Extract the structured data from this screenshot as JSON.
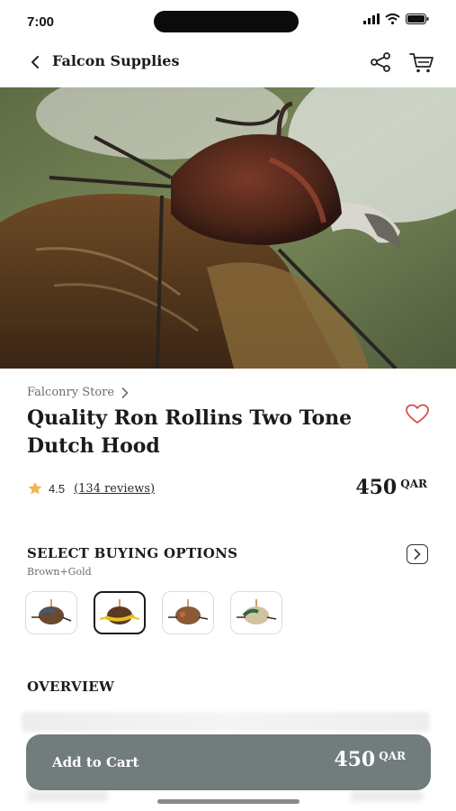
{
  "status_bar": {
    "time": "7:00"
  },
  "nav": {
    "title": "Falcon Supplies",
    "back_icon": "chevron-left-icon",
    "share_icon": "share-icon",
    "cart_icon": "cart-icon"
  },
  "hero": {
    "image": "hooded-falcon-photo"
  },
  "product": {
    "store": "Falconry Store",
    "title": "Quality Ron Rollins Two Tone Dutch Hood",
    "rating": "4.5",
    "reviews": "(134 reviews)",
    "price": "450",
    "currency": "QAR"
  },
  "options": {
    "title": "SELECT BUYING OPTIONS",
    "selected": "Brown+Gold",
    "variants": [
      "blue-brown-hood",
      "gold-hood",
      "brown-hood",
      "green-hood"
    ],
    "selected_index": 1
  },
  "overview": {
    "title": "OVERVIEW"
  },
  "cart_bar": {
    "label": "Add to Cart",
    "price": "450",
    "currency": "QAR"
  },
  "colors": {
    "accent_button": "#717c7c",
    "favorite": "#d94c4c",
    "rating_star": "#f3b45a"
  }
}
